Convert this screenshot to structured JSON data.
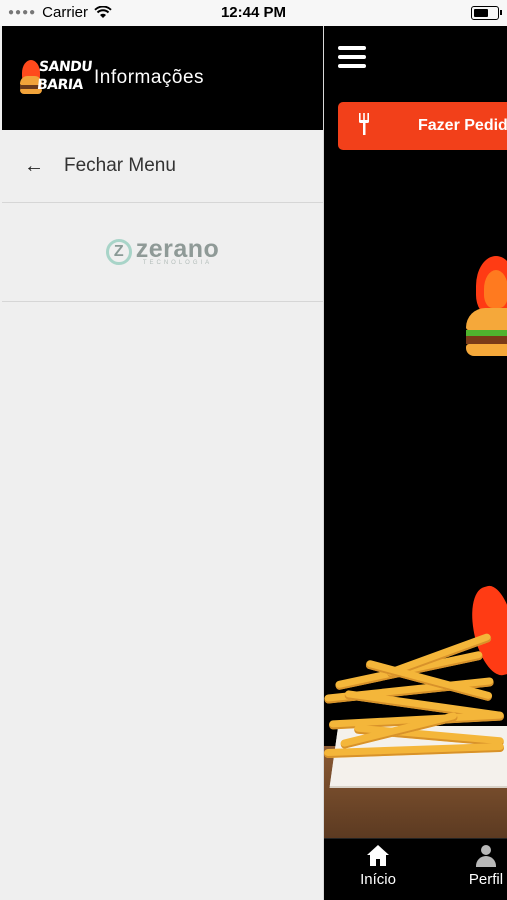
{
  "status_bar": {
    "carrier": "Carrier",
    "time": "12:44 PM"
  },
  "drawer": {
    "logo_text_line1": "SANDU",
    "logo_text_line2": "BARIA",
    "title": "Informações",
    "close_menu_label": "Fechar Menu",
    "brand_name": "zerano",
    "brand_tagline": "TECNOLOGIA"
  },
  "main": {
    "order_button_label": "Fazer Pedido"
  },
  "tabbar": {
    "home_label": "Início",
    "profile_label": "Perfil"
  },
  "colors": {
    "accent": "#f2401a",
    "header_bg": "#000000",
    "drawer_bg": "#efefef"
  }
}
